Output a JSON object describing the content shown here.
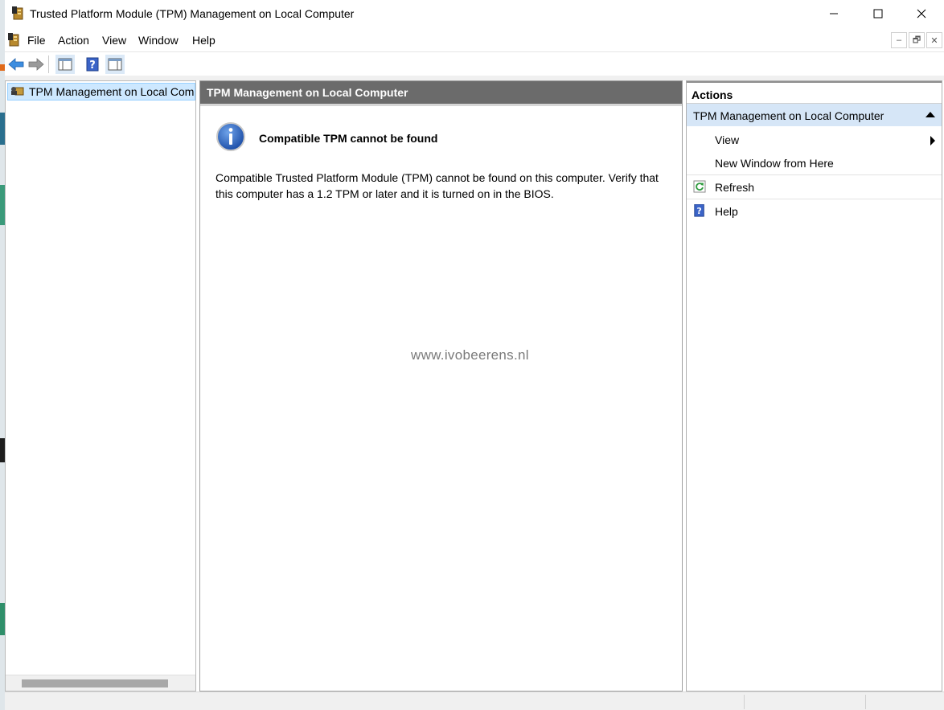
{
  "window": {
    "title": "Trusted Platform Module (TPM) Management on Local Computer"
  },
  "menu": {
    "items": [
      "File",
      "Action",
      "View",
      "Window",
      "Help"
    ]
  },
  "tree": {
    "root_label": "TPM Management on Local Compu"
  },
  "center": {
    "header": "TPM Management on Local Computer",
    "message_title": "Compatible TPM cannot be found",
    "message_line1": "Compatible Trusted Platform Module (TPM) cannot be found on this computer. Verify that",
    "message_line2": "this computer has a 1.2 TPM or later and it is turned on in the BIOS.",
    "watermark": "www.ivobeerens.nl"
  },
  "actions": {
    "header": "Actions",
    "section": "TPM Management on Local Computer",
    "items": [
      {
        "label": "View",
        "icon": "",
        "has_submenu": true
      },
      {
        "label": "New Window from Here",
        "icon": ""
      },
      {
        "label": "Refresh",
        "icon": "refresh-icon"
      },
      {
        "label": "Help",
        "icon": "help-icon"
      }
    ]
  },
  "colors": {
    "center_header_bg": "#6b6b6b",
    "actions_section_bg": "#d6e6f7",
    "tree_selection_bg": "#cde8ff"
  }
}
